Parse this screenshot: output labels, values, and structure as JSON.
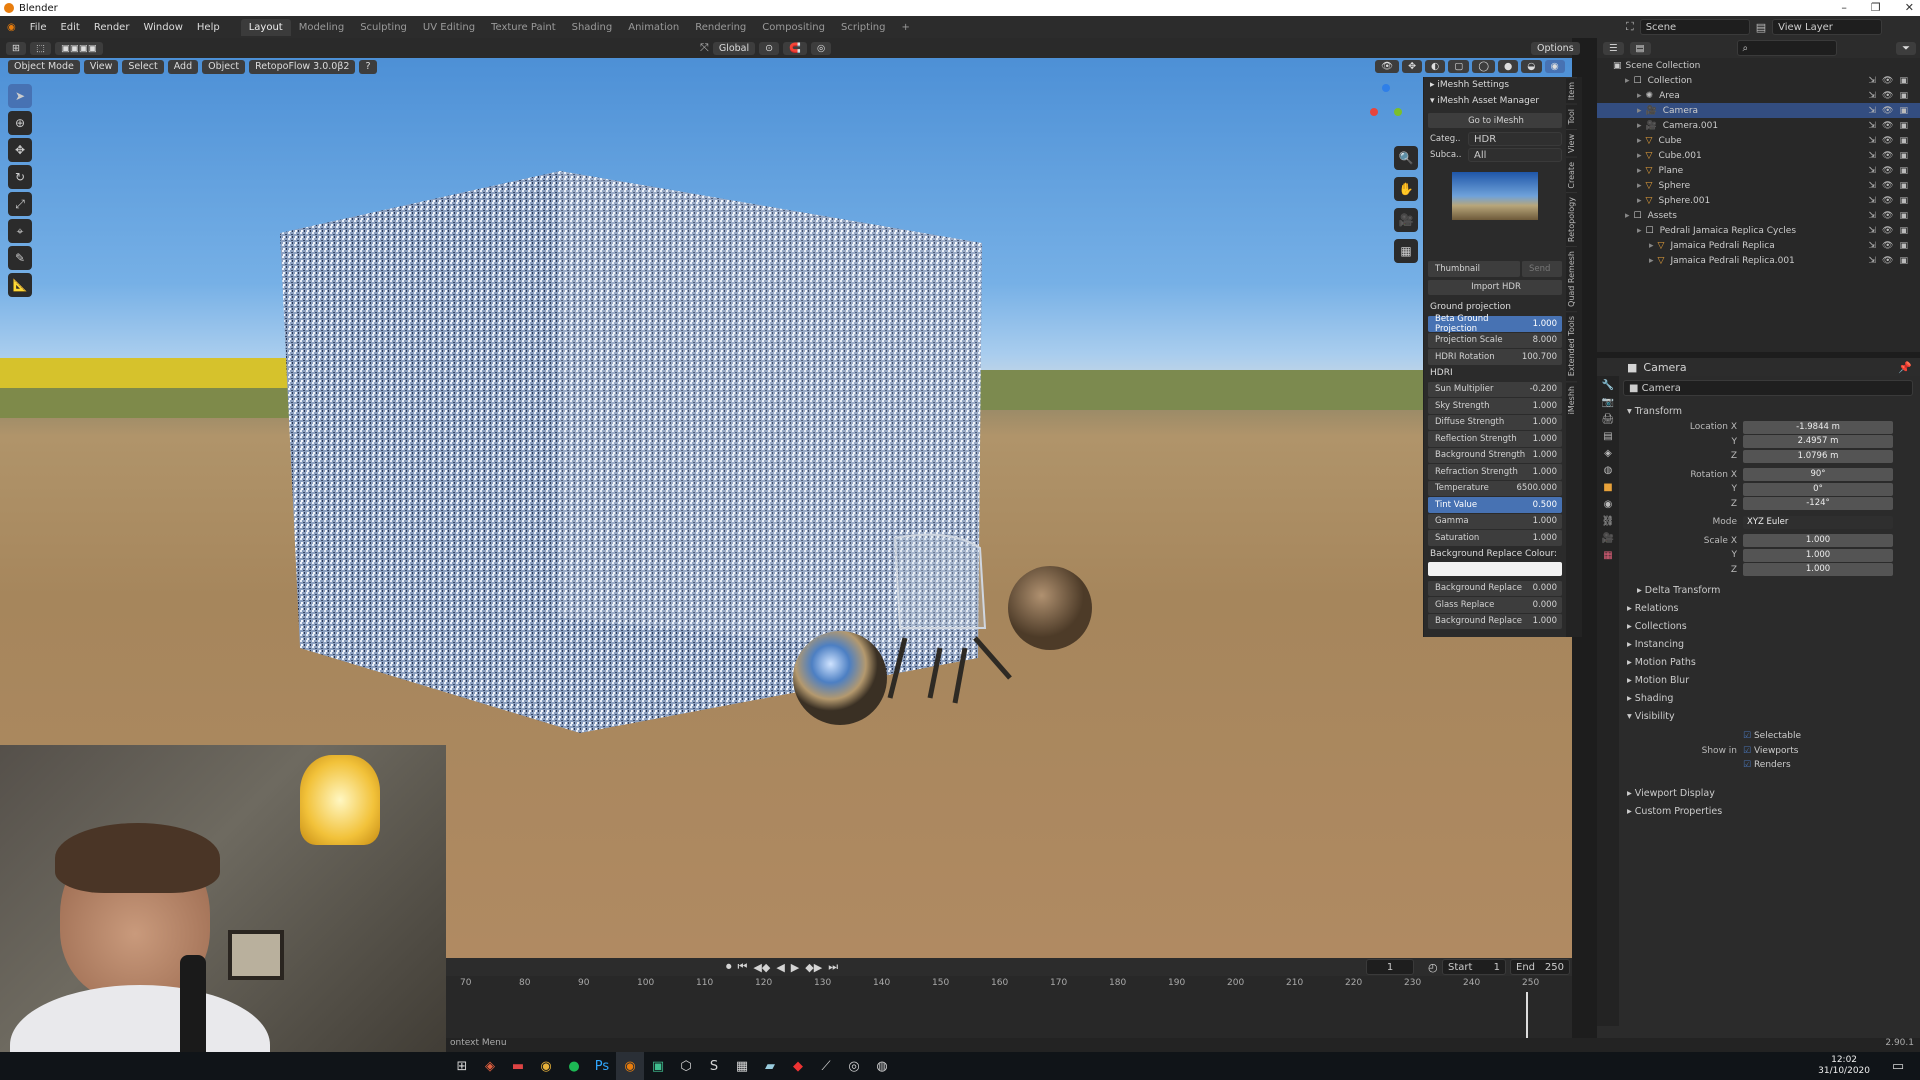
{
  "window": {
    "title": "Blender"
  },
  "menus": [
    "File",
    "Edit",
    "Render",
    "Window",
    "Help"
  ],
  "workspaces": [
    "Layout",
    "Modeling",
    "Sculpting",
    "UV Editing",
    "Texture Paint",
    "Shading",
    "Animation",
    "Rendering",
    "Compositing",
    "Scripting"
  ],
  "active_workspace": "Layout",
  "topright": {
    "scene": "Scene",
    "view_layer": "View Layer"
  },
  "toolheader": {
    "transform": "Global",
    "options": "Options"
  },
  "viewport_header": {
    "mode": "Object Mode",
    "view": "View",
    "select": "Select",
    "add": "Add",
    "object": "Object",
    "addon": "RetopoFlow 3.0.0β2"
  },
  "npanel": {
    "imeshh_settings": "iMeshh Settings",
    "asset_manager": "iMeshh Asset Manager",
    "go_to": "Go to iMeshh",
    "category_label": "Categ..",
    "category_value": "HDR",
    "subcat_label": "Subca..",
    "subcat_value": "All",
    "thumbnail": "Thumbnail",
    "send": "Send",
    "import_hdr": "Import HDR",
    "ground_projection": "Ground projection",
    "gp_rows": [
      {
        "label": "Beta Ground Projection",
        "value": "1.000",
        "hi": true
      },
      {
        "label": "Projection Scale",
        "value": "8.000"
      },
      {
        "label": "HDRI Rotation",
        "value": "100.700"
      }
    ],
    "hdri": "HDRI",
    "hdri_rows": [
      {
        "label": "Sun Multiplier",
        "value": "-0.200"
      },
      {
        "label": "Sky Strength",
        "value": "1.000"
      },
      {
        "label": "Diffuse Strength",
        "value": "1.000"
      },
      {
        "label": "Reflection Strength",
        "value": "1.000"
      },
      {
        "label": "Background Strength",
        "value": "1.000"
      },
      {
        "label": "Refraction Strength",
        "value": "1.000"
      },
      {
        "label": "Temperature",
        "value": "6500.000"
      },
      {
        "label": "Tint Value",
        "value": "0.500",
        "hi": true
      },
      {
        "label": "Gamma",
        "value": "1.000"
      },
      {
        "label": "Saturation",
        "value": "1.000"
      }
    ],
    "bg_replace_colour": "Background Replace Colour:",
    "replace_rows": [
      {
        "label": "Background Replace",
        "value": "0.000"
      },
      {
        "label": "Glass Replace",
        "value": "0.000"
      },
      {
        "label": "Background Replace",
        "value": "1.000"
      }
    ],
    "side_tabs": [
      "Item",
      "Tool",
      "View",
      "Create",
      "Retopology",
      "Quad Remesh",
      "Extended Tools",
      "iMeshh"
    ]
  },
  "outliner": {
    "root": "Scene Collection",
    "rows": [
      {
        "name": "Collection",
        "indent": 1,
        "kind": "collection"
      },
      {
        "name": "Area",
        "indent": 2,
        "kind": "light"
      },
      {
        "name": "Camera",
        "indent": 2,
        "kind": "camera",
        "selected": true
      },
      {
        "name": "Camera.001",
        "indent": 2,
        "kind": "camera"
      },
      {
        "name": "Cube",
        "indent": 2,
        "kind": "mesh"
      },
      {
        "name": "Cube.001",
        "indent": 2,
        "kind": "mesh"
      },
      {
        "name": "Plane",
        "indent": 2,
        "kind": "mesh"
      },
      {
        "name": "Sphere",
        "indent": 2,
        "kind": "mesh"
      },
      {
        "name": "Sphere.001",
        "indent": 2,
        "kind": "mesh"
      },
      {
        "name": "Assets",
        "indent": 1,
        "kind": "collection"
      },
      {
        "name": "Pedrali Jamaica Replica Cycles",
        "indent": 2,
        "kind": "collection"
      },
      {
        "name": "Jamaica Pedrali Replica",
        "indent": 3,
        "kind": "mesh"
      },
      {
        "name": "Jamaica Pedrali Replica.001",
        "indent": 3,
        "kind": "mesh"
      }
    ]
  },
  "properties": {
    "object_name": "Camera",
    "object_field": "Camera",
    "transform": "Transform",
    "location_label": "Location X",
    "location": [
      "-1.9844 m",
      "2.4957 m",
      "1.0796 m"
    ],
    "rotation_label": "Rotation X",
    "rotation": [
      "90°",
      "0°",
      "-124°"
    ],
    "mode_label": "Mode",
    "mode_value": "XYZ Euler",
    "scale_label": "Scale X",
    "scale": [
      "1.000",
      "1.000",
      "1.000"
    ],
    "axis_y": "Y",
    "axis_z": "Z",
    "delta": "Delta Transform",
    "sections": [
      "Relations",
      "Collections",
      "Instancing",
      "Motion Paths",
      "Motion Blur",
      "Shading",
      "Visibility"
    ],
    "selectable": "Selectable",
    "show_in": "Show in",
    "viewports": "Viewports",
    "renders": "Renders",
    "viewport_display": "Viewport Display",
    "custom_properties": "Custom Properties"
  },
  "timeline": {
    "current_frame": "1",
    "start_label": "Start",
    "start": "1",
    "end_label": "End",
    "end": "250",
    "ticks": [
      "70",
      "80",
      "90",
      "100",
      "110",
      "120",
      "130",
      "140",
      "150",
      "160",
      "170",
      "180",
      "190",
      "200",
      "210",
      "220",
      "230",
      "240",
      "250"
    ]
  },
  "statusbar": {
    "left": "ontext Menu",
    "version": "2.90.1"
  },
  "taskbar": {
    "time": "12:02",
    "date": "31/10/2020"
  },
  "colors": {
    "accent": "#4772b3",
    "blender_orange": "#e87d0d"
  }
}
